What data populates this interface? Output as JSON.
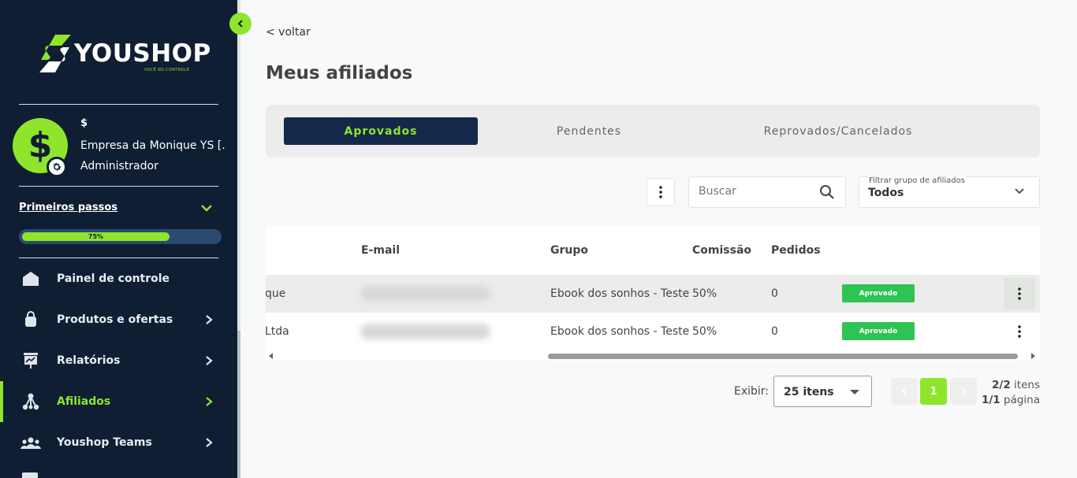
{
  "sidebar": {
    "logo_text": "YOUSHOP",
    "logo_tagline": "VOCÊ NO CONTROLE",
    "user": {
      "name": "$",
      "company": "Empresa da Monique YS [...",
      "role": "Administrador",
      "avatar_symbol": "$"
    },
    "onboarding": {
      "title": "Primeiros passos",
      "progress_label": "75%",
      "progress": 0.75
    },
    "items": [
      {
        "label": "Painel de controle",
        "icon": "home-icon",
        "active": false,
        "has_children": false
      },
      {
        "label": "Produtos e ofertas",
        "icon": "shopping-bag-icon",
        "active": false,
        "has_children": true
      },
      {
        "label": "Relatórios",
        "icon": "report-board-icon",
        "active": false,
        "has_children": true
      },
      {
        "label": "Afiliados",
        "icon": "affiliates-network-icon",
        "active": true,
        "has_children": true
      },
      {
        "label": "Youshop Teams",
        "icon": "team-icon",
        "active": false,
        "has_children": true
      }
    ]
  },
  "main": {
    "back_label": "< voltar",
    "title": "Meus afiliados",
    "tabs": [
      {
        "label": "Aprovados",
        "active": true
      },
      {
        "label": "Pendentes",
        "active": false
      },
      {
        "label": "Reprovados/Cancelados",
        "active": false
      }
    ],
    "search": {
      "placeholder": "Buscar"
    },
    "filter": {
      "label": "Filtrar grupo de afiliados",
      "value": "Todos"
    },
    "table": {
      "columns": [
        "E-mail",
        "Grupo",
        "Comissão",
        "Pedidos"
      ],
      "rows": [
        {
          "name": "que",
          "group": "Ebook dos sonhos - Teste",
          "commission": "50%",
          "orders": "0",
          "status": "Aprovado"
        },
        {
          "name": "Ltda",
          "group": "Ebook dos sonhos - Teste",
          "commission": "50%",
          "orders": "0",
          "status": "Aprovado"
        }
      ]
    },
    "pagination": {
      "show_label": "Exibir:",
      "per_page": "25 itens",
      "current_page": "1",
      "items_count": "2/2",
      "items_label": "itens",
      "pages_count": "1/1",
      "pages_label": "página"
    }
  },
  "colors": {
    "sidebar_bg": "#0f1e33",
    "accent_green": "#8ee52b",
    "tab_active_bg": "#14294a",
    "status_approved": "#2ec353"
  }
}
